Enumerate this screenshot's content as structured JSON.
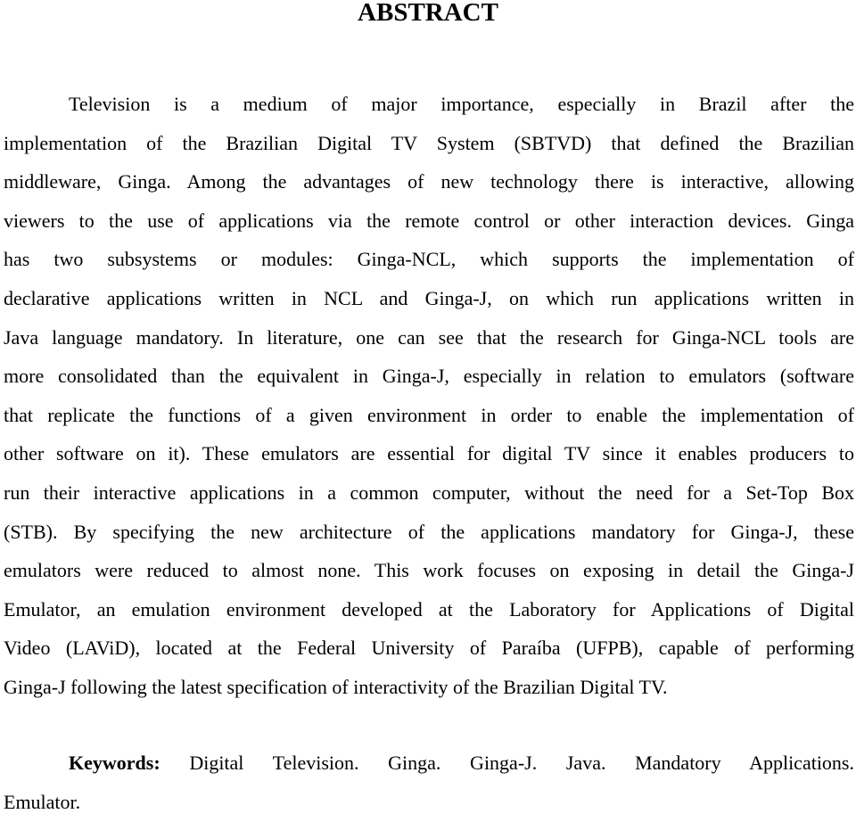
{
  "document": {
    "title": "ABSTRACT",
    "abstract_lines": [
      "Television is a medium of major importance, especially in Brazil after the",
      "implementation of the Brazilian Digital TV System (SBTVD) that defined the Brazilian",
      "middleware, Ginga. Among the advantages of new technology there is interactive, allowing",
      "viewers to the use of applications via the remote control or other interaction devices. Ginga",
      "has two subsystems or modules: Ginga-NCL, which supports the implementation of",
      "declarative applications written in NCL and Ginga-J, on which run applications written in",
      "Java language mandatory. In literature, one can see that the research for Ginga-NCL tools are",
      "more consolidated than the equivalent in Ginga-J, especially in relation to emulators (software",
      "that replicate the functions of a given environment in order to enable the implementation of",
      "other software on it). These emulators are essential for digital TV since it enables producers to",
      "run their interactive applications in a common computer, without the need for a Set-Top Box",
      "(STB). By specifying the new architecture of the applications mandatory for Ginga-J, these",
      "emulators were reduced to almost none. This work focuses on exposing in detail the Ginga-J",
      "Emulator, an emulation environment developed at the Laboratory for Applications of Digital",
      "Video (LAViD), located at the Federal University of Paraíba (UFPB), capable of performing",
      "Ginga-J following the latest specification of interactivity of the Brazilian Digital TV."
    ],
    "keywords": {
      "label": "Keywords:",
      "line1": "Digital Television. Ginga. Ginga-J. Java. Mandatory Applications.",
      "line2": "Emulator."
    }
  }
}
